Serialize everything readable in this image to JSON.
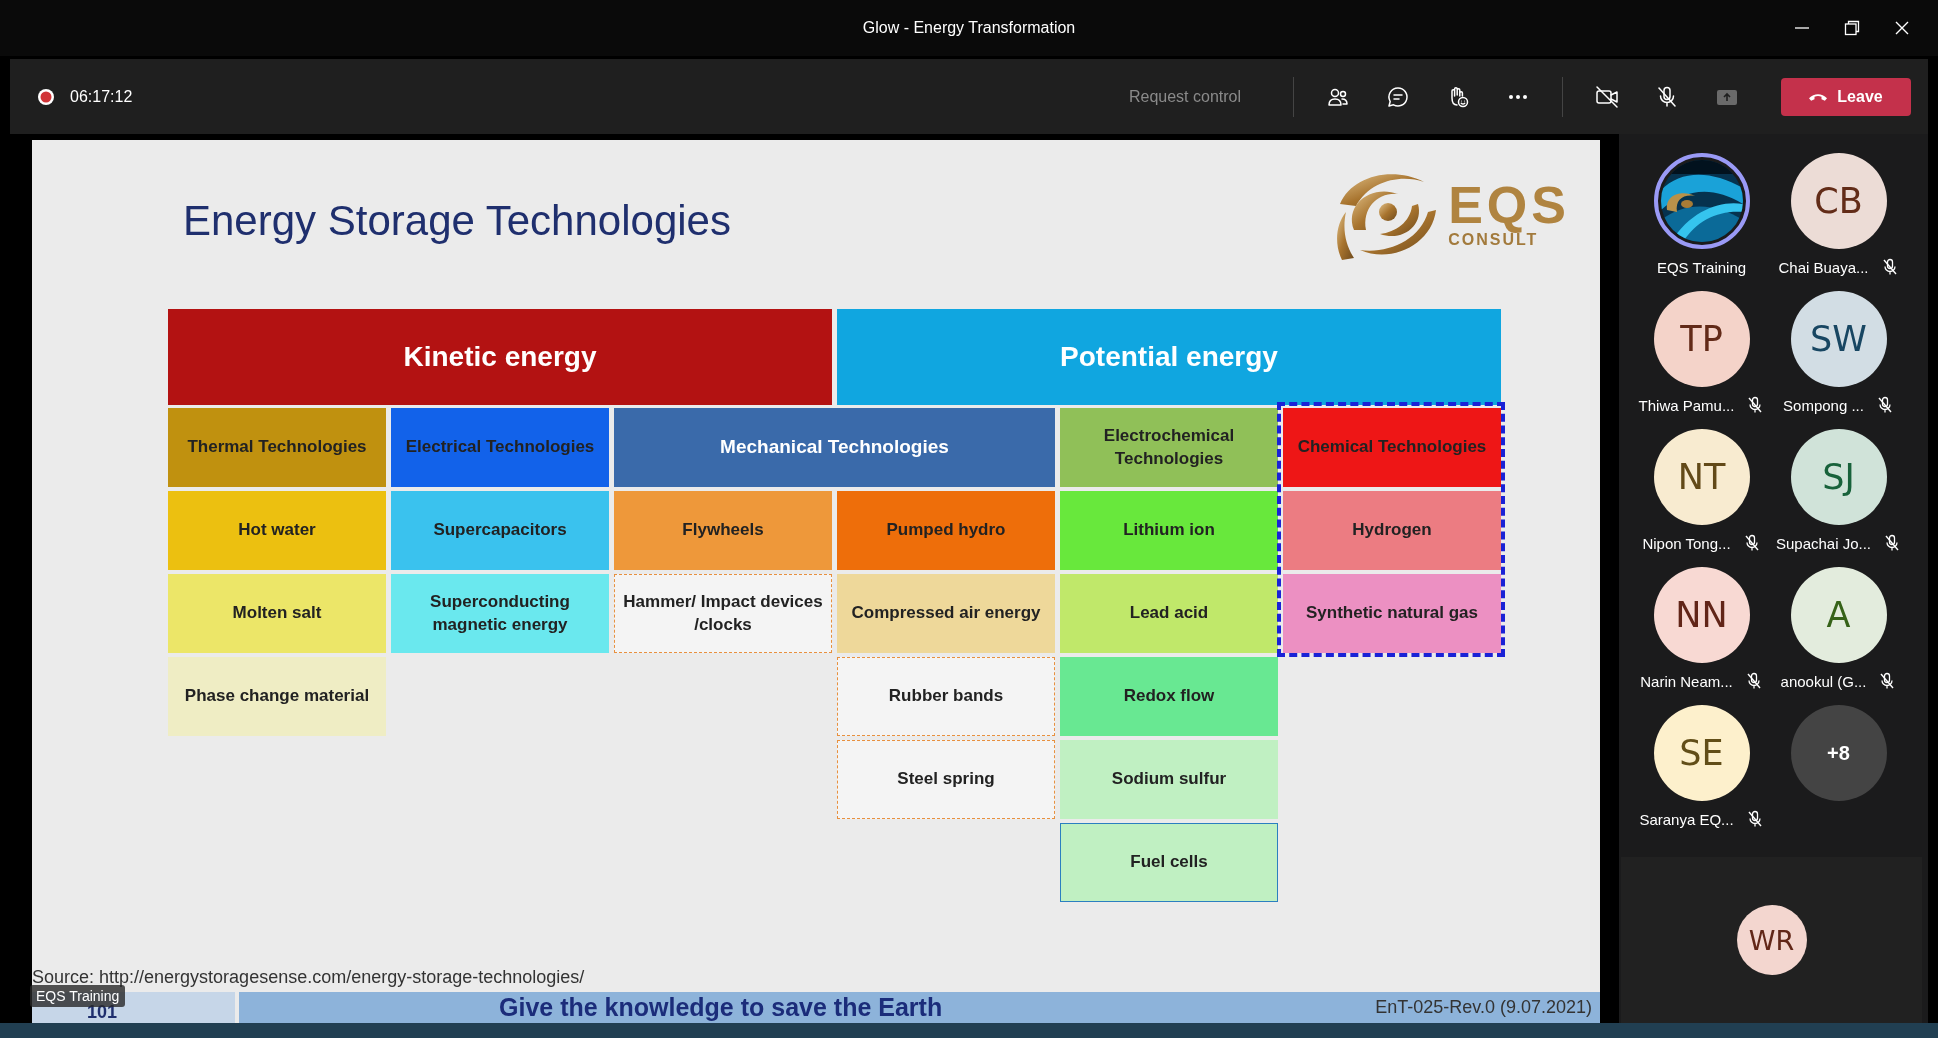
{
  "window": {
    "title": "Glow - Energy Transformation"
  },
  "toolbar": {
    "recording": true,
    "elapsed": "06:17:12",
    "request_control": "Request control",
    "camera_on": false,
    "mic_on": false,
    "leave": "Leave"
  },
  "slide": {
    "title": "Energy Storage Technologies",
    "logo": {
      "name": "EQS",
      "subtitle": "CONSULT"
    },
    "categories": [
      {
        "label": "Kinetic energy",
        "color": "#b31212"
      },
      {
        "label": "Potential energy",
        "color": "#10a6e0"
      }
    ],
    "groups": [
      {
        "label": "Thermal Technologies",
        "color": "#c0910f",
        "kind": "dark-text",
        "highlighted": false,
        "columns": [
          [
            {
              "label": "Hot water",
              "color": "#ecc010",
              "kind": "filled"
            },
            {
              "label": "Molten salt",
              "color": "#ece668",
              "kind": "filled"
            },
            {
              "label": "Phase change material",
              "color": "#efedc4",
              "kind": "filled"
            }
          ]
        ]
      },
      {
        "label": "Electrical Technologies",
        "color": "#1262ea",
        "kind": "dark-text",
        "highlighted": false,
        "columns": [
          [
            {
              "label": "Supercapacitors",
              "color": "#3ac2ee",
              "kind": "filled"
            },
            {
              "label": "Superconducting magnetic energy",
              "color": "#6ae8ee",
              "kind": "filled"
            }
          ]
        ]
      },
      {
        "label": "Mechanical Technologies",
        "color": "#3a6aaa",
        "kind": "light-text",
        "highlighted": false,
        "columns": [
          [
            {
              "label": "Flywheels",
              "color": "#ee983a",
              "kind": "filled"
            },
            {
              "label": "Hammer/ Impact devices /clocks",
              "color": "#e8903e",
              "kind": "dashed"
            }
          ],
          [
            {
              "label": "Pumped hydro",
              "color": "#ee6e0a",
              "kind": "filled"
            },
            {
              "label": "Compressed air energy",
              "color": "#eed89a",
              "kind": "filled"
            },
            {
              "label": "Rubber bands",
              "color": "#e8903e",
              "kind": "dashed"
            },
            {
              "label": "Steel spring",
              "color": "#e8903e",
              "kind": "dashed"
            }
          ]
        ]
      },
      {
        "label": "Electrochemical Technologies",
        "color": "#90c058",
        "kind": "dark-text",
        "highlighted": false,
        "columns": [
          [
            {
              "label": "Lithium ion",
              "color": "#68e83c",
              "kind": "filled"
            },
            {
              "label": "Lead acid",
              "color": "#c0e86a",
              "kind": "filled"
            },
            {
              "label": "Redox flow",
              "color": "#68e892",
              "kind": "filled"
            },
            {
              "label": "Sodium sulfur",
              "color": "#c0f0c2",
              "kind": "filled"
            },
            {
              "label": "Fuel cells",
              "color": "#c0f0c2",
              "kind": "outlined"
            }
          ]
        ]
      },
      {
        "label": "Chemical Technologies",
        "color": "#ee1616",
        "kind": "dark-text",
        "highlighted": true,
        "columns": [
          [
            {
              "label": "Hydrogen",
              "color": "#ec7c82",
              "kind": "filled"
            },
            {
              "label": "Synthetic natural gas",
              "color": "#ec90c2",
              "kind": "filled"
            }
          ]
        ]
      }
    ],
    "source": "Source: http://energystoragesense.com/energy-storage-technologies/",
    "footer": {
      "page": "101",
      "motto": "Give the knowledge to save the Earth",
      "revision": "EnT-025-Rev.0 (9.07.2021)"
    }
  },
  "presenter_label": "EQS Training",
  "participants": [
    {
      "kind": "picture",
      "name": "EQS Training",
      "speaking": true,
      "muted": false
    },
    {
      "kind": "initials",
      "initials": "CB",
      "name": "Chai Buaya...",
      "color": "#ecdcd6",
      "speaking": false,
      "muted": true
    },
    {
      "kind": "initials",
      "initials": "TP",
      "name": "Thiwa Pamu...",
      "color": "#f4d3c9",
      "speaking": false,
      "muted": true
    },
    {
      "kind": "initials",
      "initials": "SW",
      "name": "Sompong ...",
      "color": "#d2dde4",
      "speaking": false,
      "muted": true
    },
    {
      "kind": "initials",
      "initials": "NT",
      "name": "Nipon Tong...",
      "color": "#f8ebd0",
      "speaking": false,
      "muted": true
    },
    {
      "kind": "initials",
      "initials": "SJ",
      "name": "Supachai Jo...",
      "color": "#d0e3d9",
      "speaking": false,
      "muted": true
    },
    {
      "kind": "initials",
      "initials": "NN",
      "name": "Narin Neam...",
      "color": "#f8d9d3",
      "speaking": false,
      "muted": true
    },
    {
      "kind": "initials",
      "initials": "A",
      "name": "anookul (G...",
      "color": "#e3ecdd",
      "speaking": false,
      "muted": true
    },
    {
      "kind": "initials",
      "initials": "SE",
      "name": "Saranya EQ...",
      "color": "#fdf0cc",
      "speaking": false,
      "muted": true
    },
    {
      "kind": "overflow",
      "label": "+8",
      "speaking": false
    }
  ],
  "self_view": {
    "initials": "WR",
    "color": "#f3d6cf"
  }
}
